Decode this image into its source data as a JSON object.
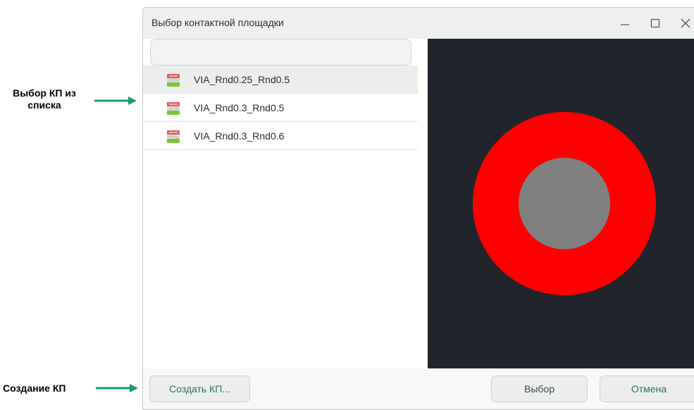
{
  "annotations": {
    "select_from_list": "Выбор КП из списка",
    "select_from_list_line1": "Выбор КП из",
    "select_from_list_line2": "списка",
    "create_pad": "Создание КП",
    "arrow_color": "#1a9b72"
  },
  "window": {
    "title": "Выбор контактной площадки",
    "controls": {
      "minimize": "—",
      "maximize": "☐",
      "close": "✕"
    }
  },
  "search": {
    "value": "",
    "placeholder": ""
  },
  "pads": [
    {
      "label": "VIA_Rnd0.25_Rnd0.5",
      "selected": true
    },
    {
      "label": "VIA_Rnd0.3_Rnd0.5",
      "selected": false
    },
    {
      "label": "VIA_Rnd0.3_Rnd0.6",
      "selected": false
    }
  ],
  "preview": {
    "background": "#21252b",
    "outer_color": "#ff0000",
    "inner_color": "#808080"
  },
  "buttons": {
    "create": "Создать КП...",
    "select": "Выбор",
    "cancel": "Отмена"
  }
}
